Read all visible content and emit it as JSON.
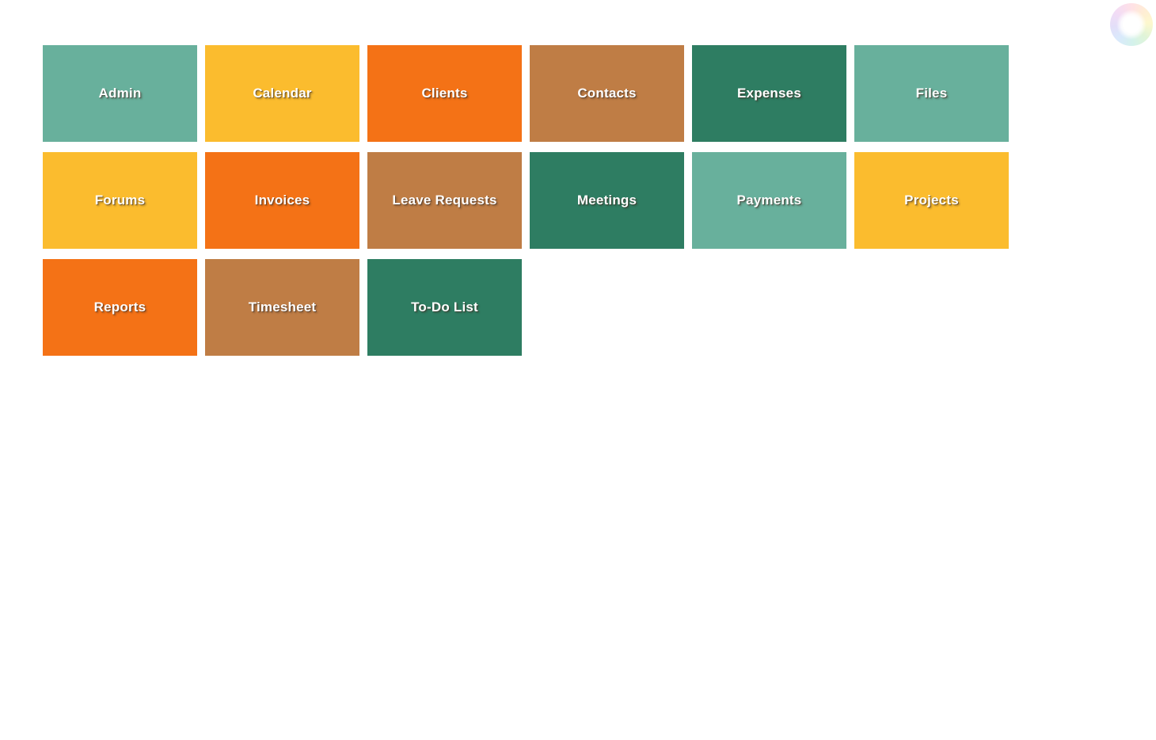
{
  "palette": {
    "teal_light": "#68b09c",
    "yellow": "#fbbc2e",
    "orange": "#f47216",
    "tan": "#bf7d45",
    "green_dark": "#2e7d62",
    "background": "#ffffff",
    "label_color": "#ffffff"
  },
  "header": {
    "color_wheel_icon": "color-wheel-icon"
  },
  "grid": {
    "columns": 6,
    "tiles": [
      {
        "label": "Admin",
        "color": "#68b09c"
      },
      {
        "label": "Calendar",
        "color": "#fbbc2e"
      },
      {
        "label": "Clients",
        "color": "#f47216"
      },
      {
        "label": "Contacts",
        "color": "#bf7d45"
      },
      {
        "label": "Expenses",
        "color": "#2e7d62"
      },
      {
        "label": "Files",
        "color": "#68b09c"
      },
      {
        "label": "Forums",
        "color": "#fbbc2e"
      },
      {
        "label": "Invoices",
        "color": "#f47216"
      },
      {
        "label": "Leave Requests",
        "color": "#bf7d45"
      },
      {
        "label": "Meetings",
        "color": "#2e7d62"
      },
      {
        "label": "Payments",
        "color": "#68b09c"
      },
      {
        "label": "Projects",
        "color": "#fbbc2e"
      },
      {
        "label": "Reports",
        "color": "#f47216"
      },
      {
        "label": "Timesheet",
        "color": "#bf7d45"
      },
      {
        "label": "To-Do List",
        "color": "#2e7d62"
      }
    ]
  }
}
